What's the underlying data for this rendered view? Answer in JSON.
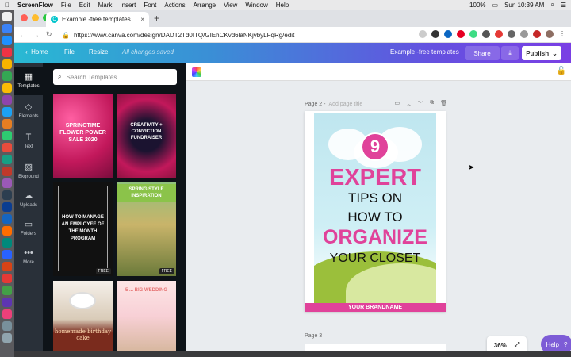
{
  "menubar": {
    "apple": "",
    "app": "ScreenFlow",
    "items": [
      "File",
      "Edit",
      "Mark",
      "Insert",
      "Font",
      "Actions",
      "Arrange",
      "View",
      "Window",
      "Help"
    ],
    "battery": "100%",
    "clock": "Sun 10:39 AM"
  },
  "browser": {
    "tab_title": "Example -free templates",
    "tab_close": "×",
    "new_tab": "+",
    "url": "https://www.canva.com/design/DADT2Td0ITQ/GIEhCKvd6laNKjvbyLFqRg/edit"
  },
  "canva_bar": {
    "home": "Home",
    "file": "File",
    "resize": "Resize",
    "saved_status": "All changes saved",
    "doc_title": "Example -free templates",
    "share": "Share",
    "publish": "Publish"
  },
  "rail": {
    "items": [
      {
        "label": "Templates",
        "icon": "▦"
      },
      {
        "label": "Elements",
        "icon": "◇"
      },
      {
        "label": "Text",
        "icon": "T"
      },
      {
        "label": "Bkground",
        "icon": "▨"
      },
      {
        "label": "Uploads",
        "icon": "☁"
      },
      {
        "label": "Folders",
        "icon": "▭"
      },
      {
        "label": "More",
        "icon": "•••"
      }
    ]
  },
  "panel": {
    "search_placeholder": "Search Templates",
    "templates": [
      {
        "text": "SPRINGTIME FLOWER POWER SALE 2020",
        "badge": ""
      },
      {
        "text": "CREATIVITY + CONVICTION FUNDRAISER",
        "badge": ""
      },
      {
        "text": "HOW TO MANAGE AN EMPLOYEE OF THE MONTH PROGRAM",
        "badge": "FREE"
      },
      {
        "text": "SPRING STYLE INSPIRATION",
        "badge": "FREE"
      },
      {
        "text": "homemade birthday cake",
        "badge": ""
      },
      {
        "text": "5 ... BIG WEDDING",
        "badge": ""
      }
    ]
  },
  "editor": {
    "page2_label": "Page 2 -",
    "page2_title_placeholder": "Add page title",
    "page3_label": "Page 3",
    "zoom": "36%",
    "help": "Help",
    "help_icon": "?"
  },
  "poster": {
    "number": "9",
    "line1": "EXPERT",
    "line2": "TIPS ON",
    "line3": "HOW TO",
    "line4": "ORGANIZE",
    "line5": "YOUR CLOSET",
    "brand": "YOUR BRANDNAME"
  },
  "colors": {
    "accent_pink": "#e0429a",
    "canva_gradient_start": "#29b9d3",
    "canva_gradient_end": "#7a3fe4",
    "help_purple": "#7d5cd6"
  }
}
